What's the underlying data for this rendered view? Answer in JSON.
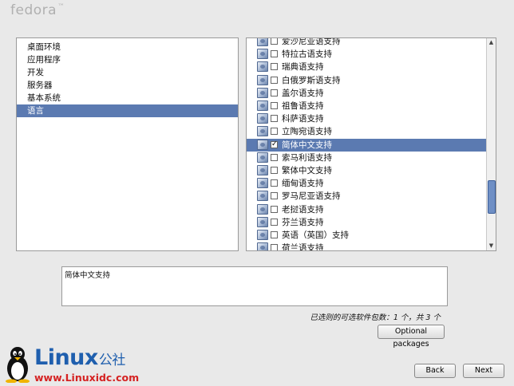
{
  "header": {
    "logo_text": "fedora",
    "logo_mark": "™"
  },
  "categories": [
    {
      "label": "桌面环境",
      "selected": false
    },
    {
      "label": "应用程序",
      "selected": false
    },
    {
      "label": "开发",
      "selected": false
    },
    {
      "label": "服务器",
      "selected": false
    },
    {
      "label": "基本系统",
      "selected": false
    },
    {
      "label": "语言",
      "selected": true
    }
  ],
  "packages": [
    {
      "label": "爱沙尼亚语支持",
      "checked": false,
      "selected": false
    },
    {
      "label": "特拉古语支持",
      "checked": false,
      "selected": false
    },
    {
      "label": "瑞典语支持",
      "checked": false,
      "selected": false
    },
    {
      "label": "白俄罗斯语支持",
      "checked": false,
      "selected": false
    },
    {
      "label": "盖尔语支持",
      "checked": false,
      "selected": false
    },
    {
      "label": "祖鲁语支持",
      "checked": false,
      "selected": false
    },
    {
      "label": "科萨语支持",
      "checked": false,
      "selected": false
    },
    {
      "label": "立陶宛语支持",
      "checked": false,
      "selected": false
    },
    {
      "label": "简体中文支持",
      "checked": true,
      "selected": true
    },
    {
      "label": "索马利语支持",
      "checked": false,
      "selected": false
    },
    {
      "label": "繁体中文支持",
      "checked": false,
      "selected": false
    },
    {
      "label": "缅甸语支持",
      "checked": false,
      "selected": false
    },
    {
      "label": "罗马尼亚语支持",
      "checked": false,
      "selected": false
    },
    {
      "label": "老挝语支持",
      "checked": false,
      "selected": false
    },
    {
      "label": "芬兰语支持",
      "checked": false,
      "selected": false
    },
    {
      "label": "英语（英国）支持",
      "checked": false,
      "selected": false
    },
    {
      "label": "荷兰语支持",
      "checked": false,
      "selected": false
    }
  ],
  "description": {
    "text": "简体中文支持"
  },
  "count_text": "已选则的可选软件包数：1 个，共 3 个",
  "buttons": {
    "optional_packages": "Optional packages",
    "back": "Back",
    "next": "Next"
  },
  "watermark": {
    "brand": "Linux",
    "brand_cn": "公社",
    "url": "www.Linuxidc.com"
  },
  "colors": {
    "selection": "#5b7ab1",
    "watermark_blue": "#1f5fae",
    "watermark_red": "#d52222"
  }
}
